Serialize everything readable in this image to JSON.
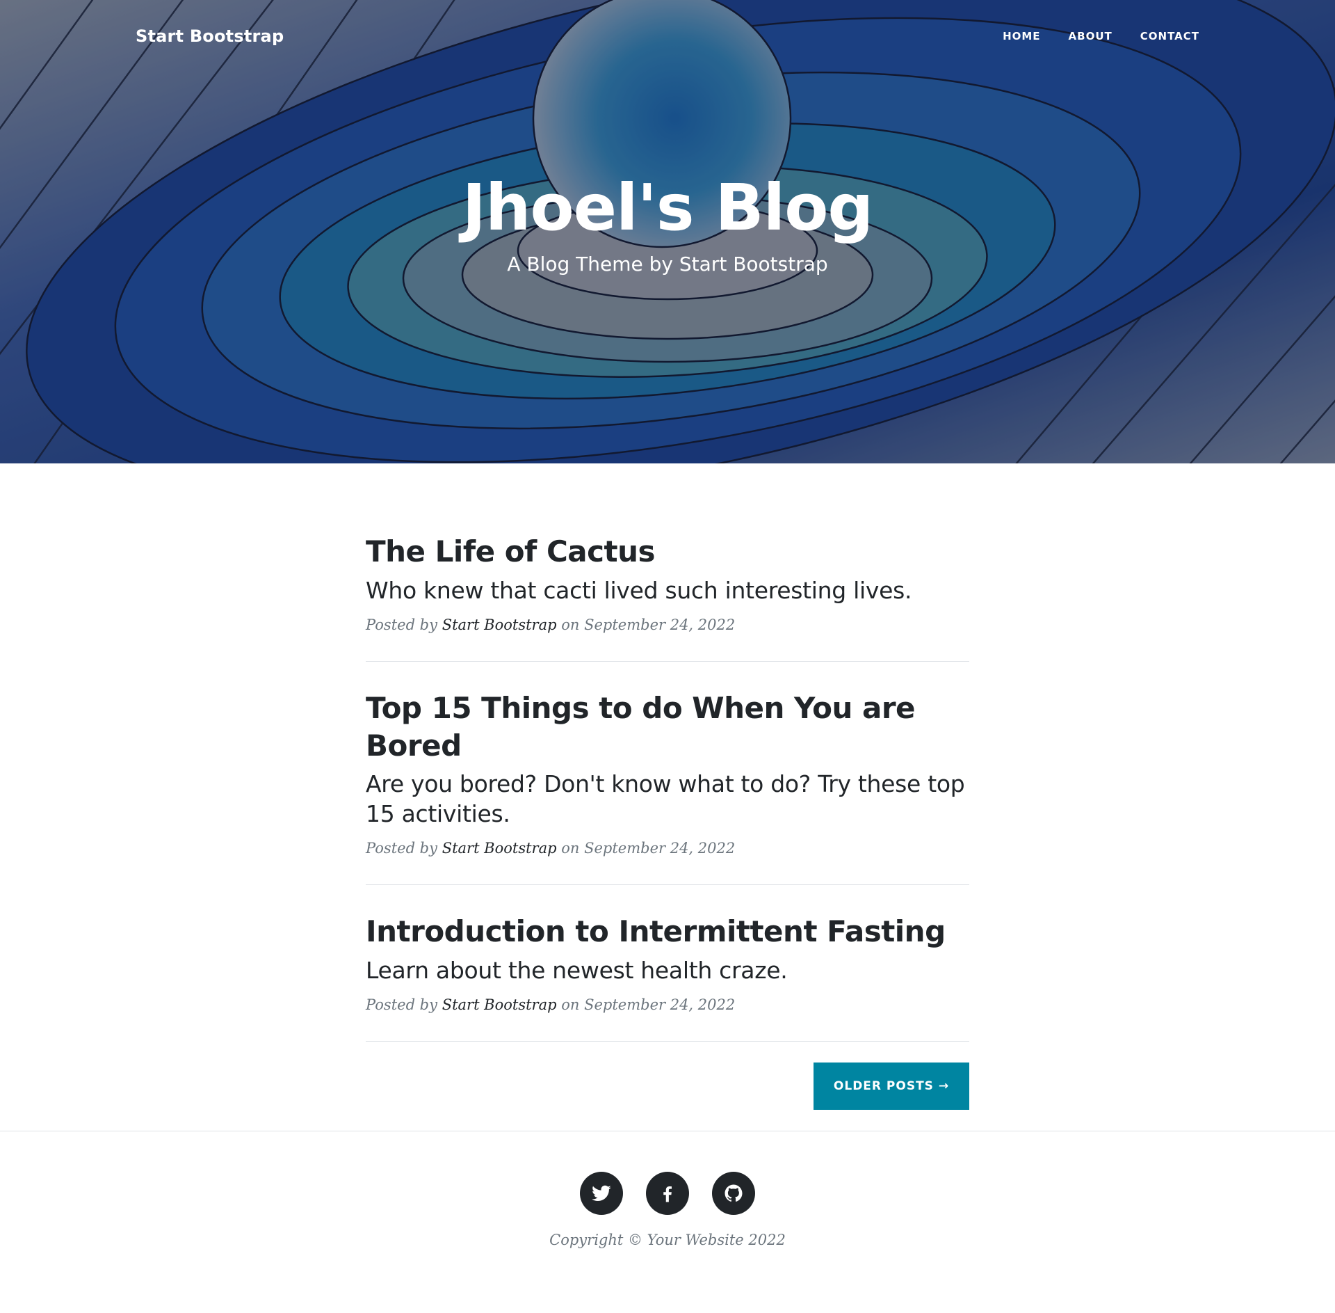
{
  "navbar": {
    "brand": "Start Bootstrap",
    "links": [
      "Home",
      "About",
      "Contact"
    ]
  },
  "hero": {
    "title": "Jhoel's Blog",
    "subtitle": "A Blog Theme by Start Bootstrap"
  },
  "posts": [
    {
      "title": "The Life of Cactus",
      "subtitle": "Who knew that cacti lived such interesting lives.",
      "posted_by": "Posted by",
      "author": "Start Bootstrap",
      "date": "on September 24, 2022"
    },
    {
      "title": "Top 15 Things to do When You are Bored",
      "subtitle": "Are you bored? Don't know what to do? Try these top 15 activities.",
      "posted_by": "Posted by",
      "author": "Start Bootstrap",
      "date": "on September 24, 2022"
    },
    {
      "title": "Introduction to Intermittent Fasting",
      "subtitle": "Learn about the newest health craze.",
      "posted_by": "Posted by",
      "author": "Start Bootstrap",
      "date": "on September 24, 2022"
    }
  ],
  "pager": {
    "older_label": "Older Posts →"
  },
  "footer": {
    "social_icons": [
      "twitter-icon",
      "facebook-icon",
      "github-icon"
    ],
    "copyright": "Copyright © Your Website 2022"
  },
  "colors": {
    "accent": "#0085a1",
    "text": "#212529",
    "muted": "#6c757d",
    "divider": "#dee2e6"
  }
}
